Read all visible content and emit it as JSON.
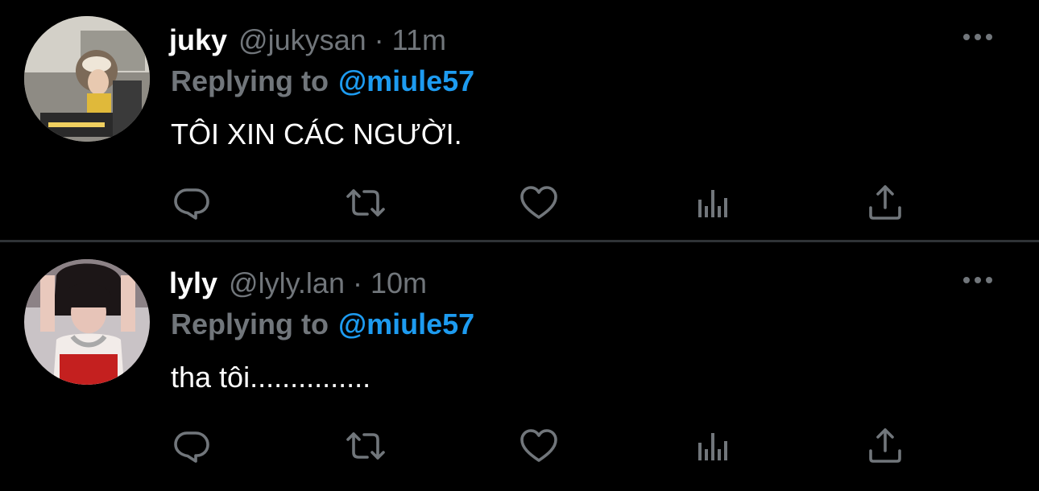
{
  "tweets": [
    {
      "name": "juky",
      "handle": "@jukysan",
      "separator": "·",
      "time": "11m",
      "reply_label": "Replying to",
      "reply_user": "@miule57",
      "text": "TÔI XIN CÁC NGƯỜI."
    },
    {
      "name": "lyly",
      "handle": "@lyly.lan",
      "separator": "·",
      "time": "10m",
      "reply_label": "Replying to",
      "reply_user": "@miule57",
      "text": "tha tôi..............."
    }
  ],
  "icons": {
    "more": "more-dots-icon",
    "reply": "reply-bubble-icon",
    "retweet": "retweet-icon",
    "like": "heart-icon",
    "stats": "bar-chart-icon",
    "share": "share-upload-icon"
  },
  "colors": {
    "background": "#000000",
    "text": "#ffffff",
    "muted": "#71767b",
    "accent": "#1d9bf0",
    "divider": "#2f3336"
  }
}
